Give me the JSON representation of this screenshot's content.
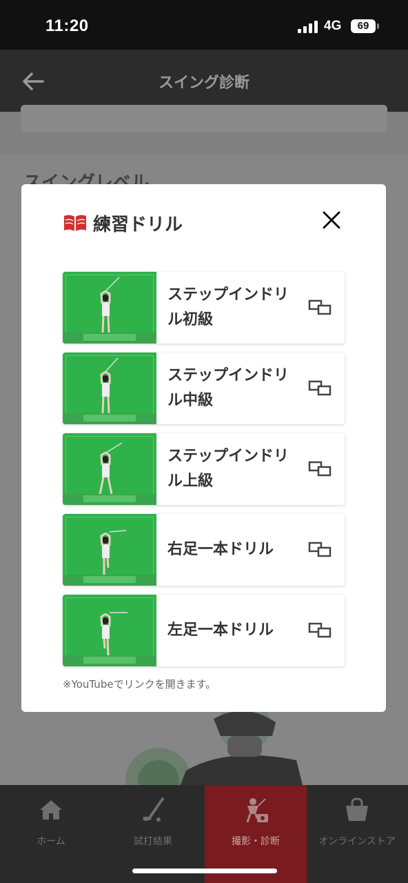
{
  "status": {
    "time": "11:20",
    "network": "4G",
    "battery": "69"
  },
  "header": {
    "title": "スイング診断"
  },
  "background": {
    "section_heading": "スイングレベル"
  },
  "modal": {
    "title": "練習ドリル",
    "drills": [
      {
        "label": "ステップインドリル初級"
      },
      {
        "label": "ステップインドリル中級"
      },
      {
        "label": "ステップインドリル上級"
      },
      {
        "label": "右足一本ドリル"
      },
      {
        "label": "左足一本ドリル"
      }
    ],
    "note": "※YouTubeでリンクを開きます。"
  },
  "nav": {
    "items": [
      {
        "label": "ホーム",
        "icon": "home-icon"
      },
      {
        "label": "試打結果",
        "icon": "golf-club-icon"
      },
      {
        "label": "撮影・診断",
        "icon": "golfer-camera-icon",
        "active": true
      },
      {
        "label": "オンラインストア",
        "icon": "shopping-bag-icon"
      }
    ]
  },
  "colors": {
    "accent": "#7a1b1f",
    "thumb_green": "#2fb24a",
    "book_red": "#d32f2f"
  }
}
